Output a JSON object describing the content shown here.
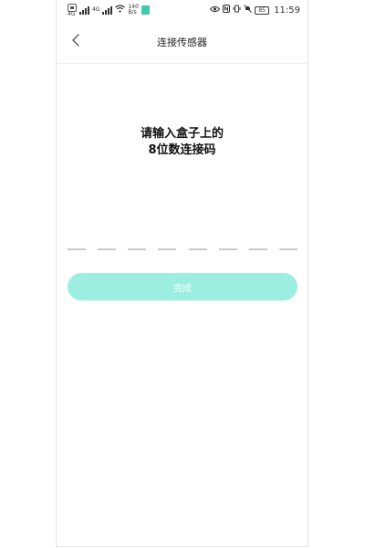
{
  "status_bar": {
    "network_left": "4G",
    "network_right": "4G",
    "speed_value": "140",
    "speed_unit": "B/s",
    "battery": "85",
    "time": "11:59"
  },
  "header": {
    "title": "连接传感器",
    "back_icon": "chevron-left-icon"
  },
  "prompt": {
    "line1": "请输入盒子上的",
    "line2": "8位数连接码"
  },
  "code_input": {
    "length": 8
  },
  "actions": {
    "done_label": "完成"
  },
  "colors": {
    "accent": "#9ceee0",
    "app_badge": "#3fcbab"
  }
}
